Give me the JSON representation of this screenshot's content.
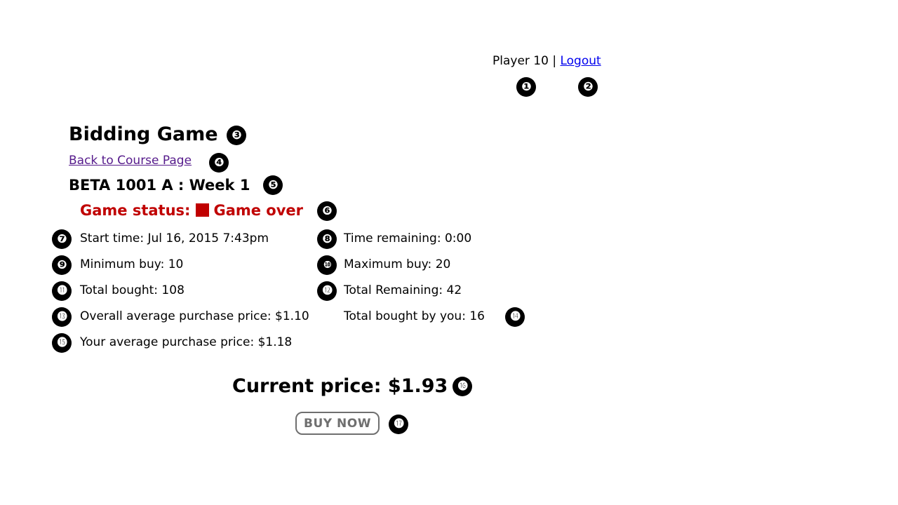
{
  "header": {
    "player_label": "Player 10",
    "separator": "|",
    "logout_label": "Logout"
  },
  "main": {
    "title": "Bidding Game",
    "back_link": "Back to Course Page",
    "course_title": "BETA 1001 A : Week 1",
    "status_label": "Game status:",
    "status_value": "Game over",
    "stats": {
      "start_time": "Start time: Jul 16, 2015 7:43pm",
      "time_remaining": "Time remaining: 0:00",
      "minimum_buy": "Minimum buy: 10",
      "maximum_buy": "Maximum buy: 20",
      "total_bought": "Total bought: 108",
      "total_remaining": "Total Remaining: 42",
      "overall_avg_price": "Overall average purchase price: $1.10",
      "total_bought_by_you": "Total bought by you: 16",
      "your_avg_price": "Your average purchase price: $1.18"
    },
    "current_price": "Current price: $1.93",
    "buy_button": "BUY NOW"
  },
  "callouts": [
    "❶",
    "❷",
    "❸",
    "❹",
    "❺",
    "❻",
    "❼",
    "❽",
    "❾",
    "❿",
    "⓫",
    "⓬",
    "⓭",
    "⓮",
    "⓯",
    "⓰",
    "⓱"
  ],
  "colors": {
    "status_red": "#c00000",
    "link_blue": "#0000ee",
    "visited_purple": "#551a8b",
    "button_gray": "#6f6f6f"
  }
}
